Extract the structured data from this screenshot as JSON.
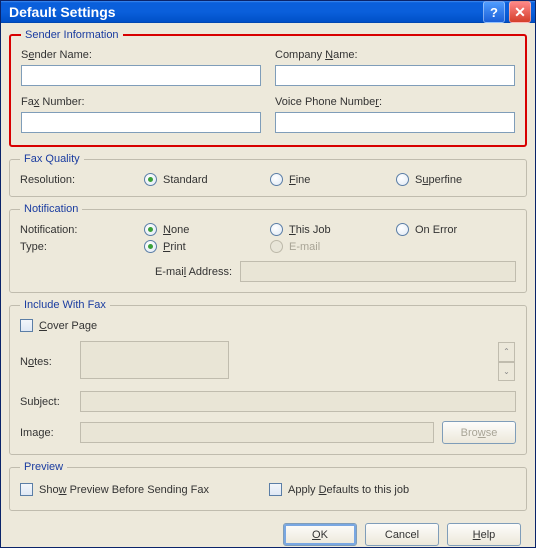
{
  "title": "Default Settings",
  "sender": {
    "legend": "Sender Information",
    "name_label_pre": "S",
    "name_label_u": "e",
    "name_label_post": "nder Name:",
    "company_label_pre": "Company ",
    "company_label_u": "N",
    "company_label_post": "ame:",
    "fax_label_pre": "Fa",
    "fax_label_u": "x",
    "fax_label_post": " Number:",
    "voice_label_pre": "Voice Phone Numbe",
    "voice_label_u": "r",
    "voice_label_post": ":",
    "sender_name": "",
    "company_name": "",
    "fax_number": "",
    "voice_number": ""
  },
  "quality": {
    "legend": "Fax Quality",
    "label": "Resolution:",
    "opts": {
      "standard": "Standard",
      "fine_u": "F",
      "fine_post": "ine",
      "super_pre": "S",
      "super_u": "u",
      "super_post": "perfine"
    },
    "selected": "standard"
  },
  "notif": {
    "legend": "Notification",
    "n_label": "Notification:",
    "t_label": "Type:",
    "opts": {
      "none_u": "N",
      "none_post": "one",
      "this_u": "T",
      "this_post": "his Job",
      "onerr": "On Error",
      "print_u": "P",
      "print_post": "rint",
      "email": "E-mail"
    },
    "n_selected": "none",
    "t_selected": "print",
    "email_label_pre": "E-mai",
    "email_label_u": "l",
    "email_label_post": " Address:",
    "email_value": ""
  },
  "include": {
    "legend": "Include With Fax",
    "cover_u": "C",
    "cover_post": "over Page",
    "notes_label_pre": "N",
    "notes_label_u": "o",
    "notes_label_post": "tes:",
    "subject_label_pre": "Sub",
    "subject_label_u": "j",
    "subject_label_post": "ect:",
    "image_label_pre": "Ima",
    "image_label_u": "g",
    "image_label_post": "e:",
    "browse_pre": "Bro",
    "browse_u": "w",
    "browse_post": "se",
    "notes": "",
    "subject": "",
    "image": ""
  },
  "preview": {
    "legend": "Preview",
    "show_pre": "Sho",
    "show_u": "w",
    "show_post": " Preview Before Sending Fax",
    "apply_pre": "Apply ",
    "apply_u": "D",
    "apply_post": "efaults to this job"
  },
  "buttons": {
    "ok_u": "O",
    "ok_post": "K",
    "cancel": "Cancel",
    "help_u": "H",
    "help_post": "elp"
  }
}
